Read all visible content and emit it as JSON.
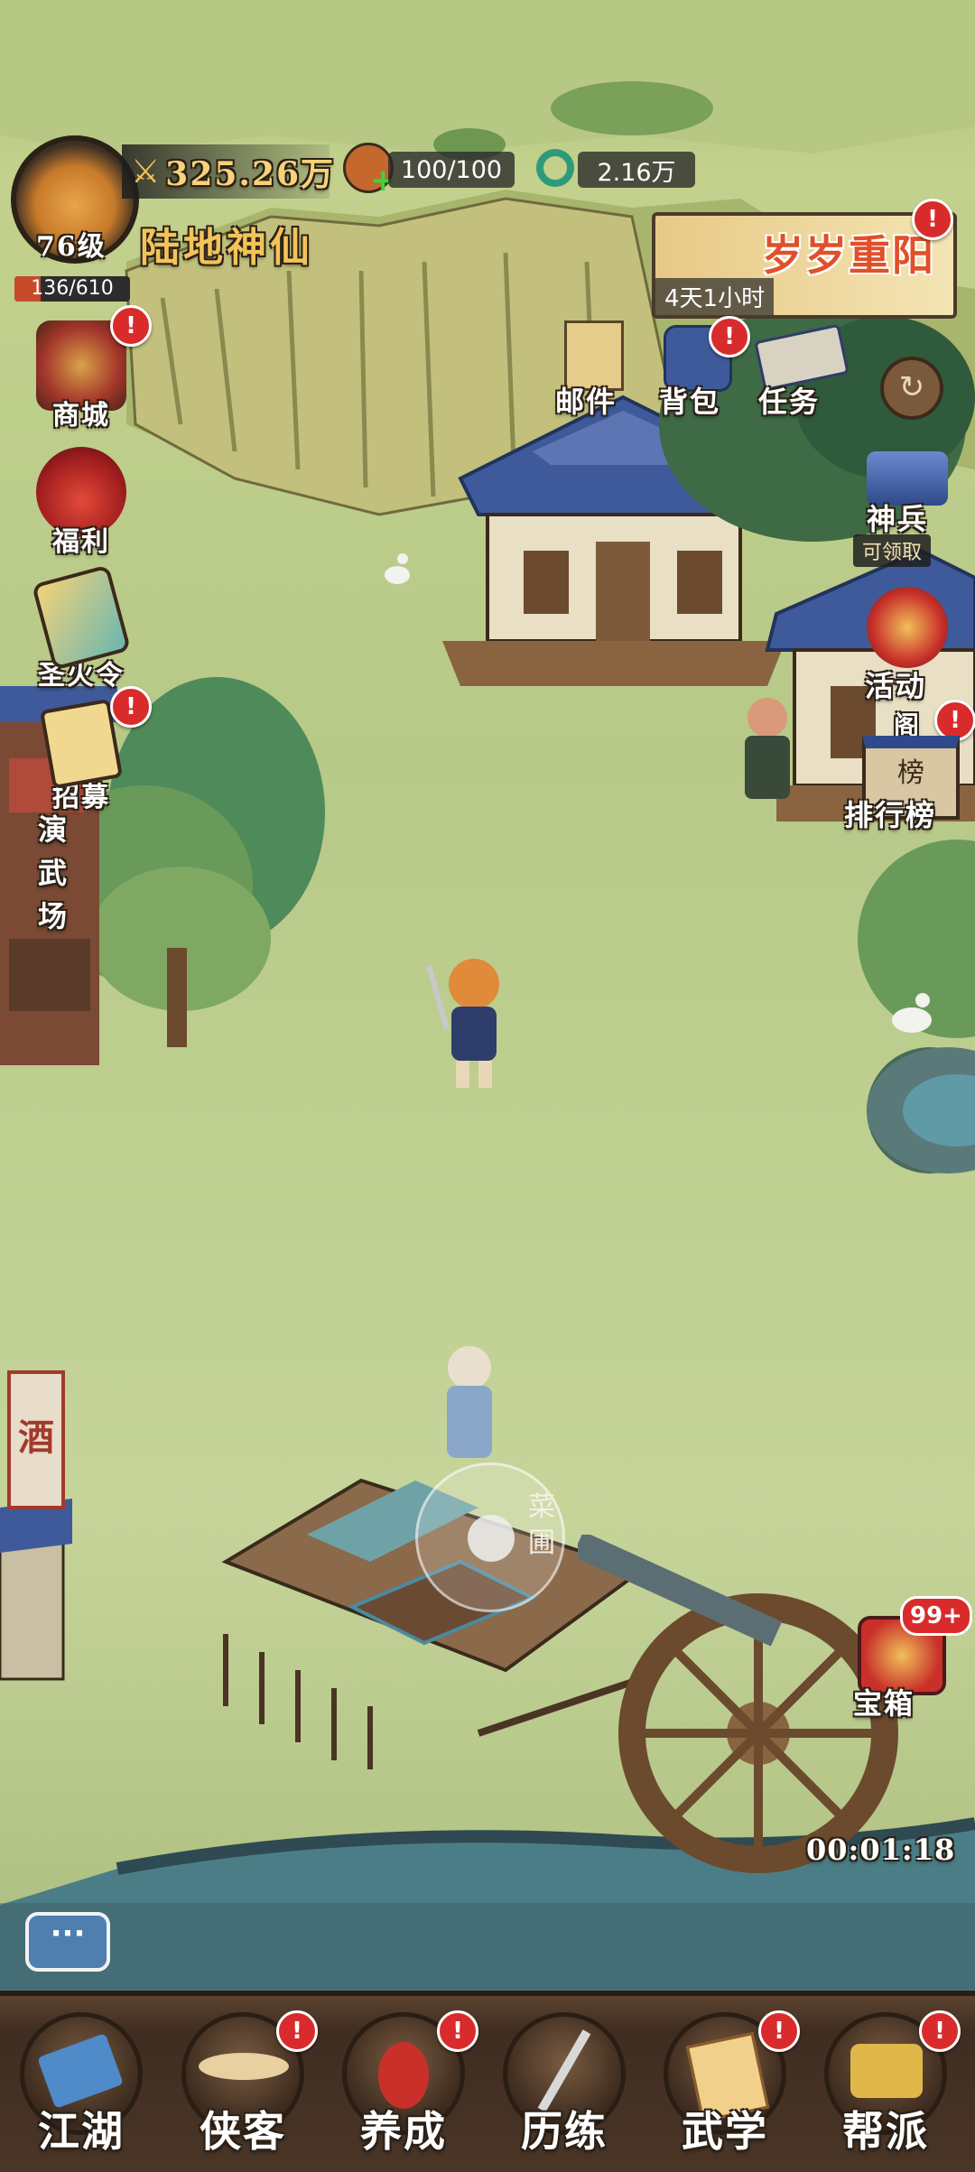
{
  "player": {
    "level": "76级",
    "power": "325.26万",
    "title_banner": "陆地神仙",
    "exp": "136/610",
    "exp_fraction": 0.223
  },
  "resources": {
    "stamina": "100/100",
    "coins": "2.16万"
  },
  "event_banner": {
    "title": "岁岁重阳",
    "time_left": "4天1小时"
  },
  "left_menu": [
    {
      "label": "商城",
      "icon": "shop-icon"
    },
    {
      "label": "福利",
      "icon": "gift-bag-icon"
    },
    {
      "label": "圣火令",
      "icon": "token-icon"
    },
    {
      "label": "招募",
      "icon": "recruit-icon"
    }
  ],
  "top_right_menu": [
    {
      "label": "邮件",
      "icon": "mail-icon"
    },
    {
      "label": "背包",
      "icon": "backpack-icon"
    },
    {
      "label": "任务",
      "icon": "scroll-icon"
    }
  ],
  "right_menu": {
    "weapon": {
      "label": "神兵",
      "badge": "可领取"
    },
    "activity": {
      "label": "活动"
    },
    "ranking": {
      "label": "排行榜",
      "sign": "榜"
    }
  },
  "map_labels": {
    "arena": "演武场",
    "pavilion": "阁",
    "garden": "菜圃",
    "wine_flag": "酒"
  },
  "treasure": {
    "label": "宝箱",
    "badge": "99+",
    "timer": "00:01:18"
  },
  "bottom_tabs": [
    {
      "label": "江湖",
      "icon": "map-scroll-icon",
      "alert": false
    },
    {
      "label": "侠客",
      "icon": "hat-icon",
      "alert": true
    },
    {
      "label": "养成",
      "icon": "gourd-icon",
      "alert": true
    },
    {
      "label": "历练",
      "icon": "sword-icon",
      "alert": false
    },
    {
      "label": "武学",
      "icon": "book-icon",
      "alert": true
    },
    {
      "label": "帮派",
      "icon": "banner-icon",
      "alert": true
    }
  ],
  "alert_mark": "!",
  "colors": {
    "grass": "#b9c98a",
    "roof_blue": "#3f5a9a",
    "alert_red": "#d92b2b",
    "gold": "#f3c35a"
  }
}
